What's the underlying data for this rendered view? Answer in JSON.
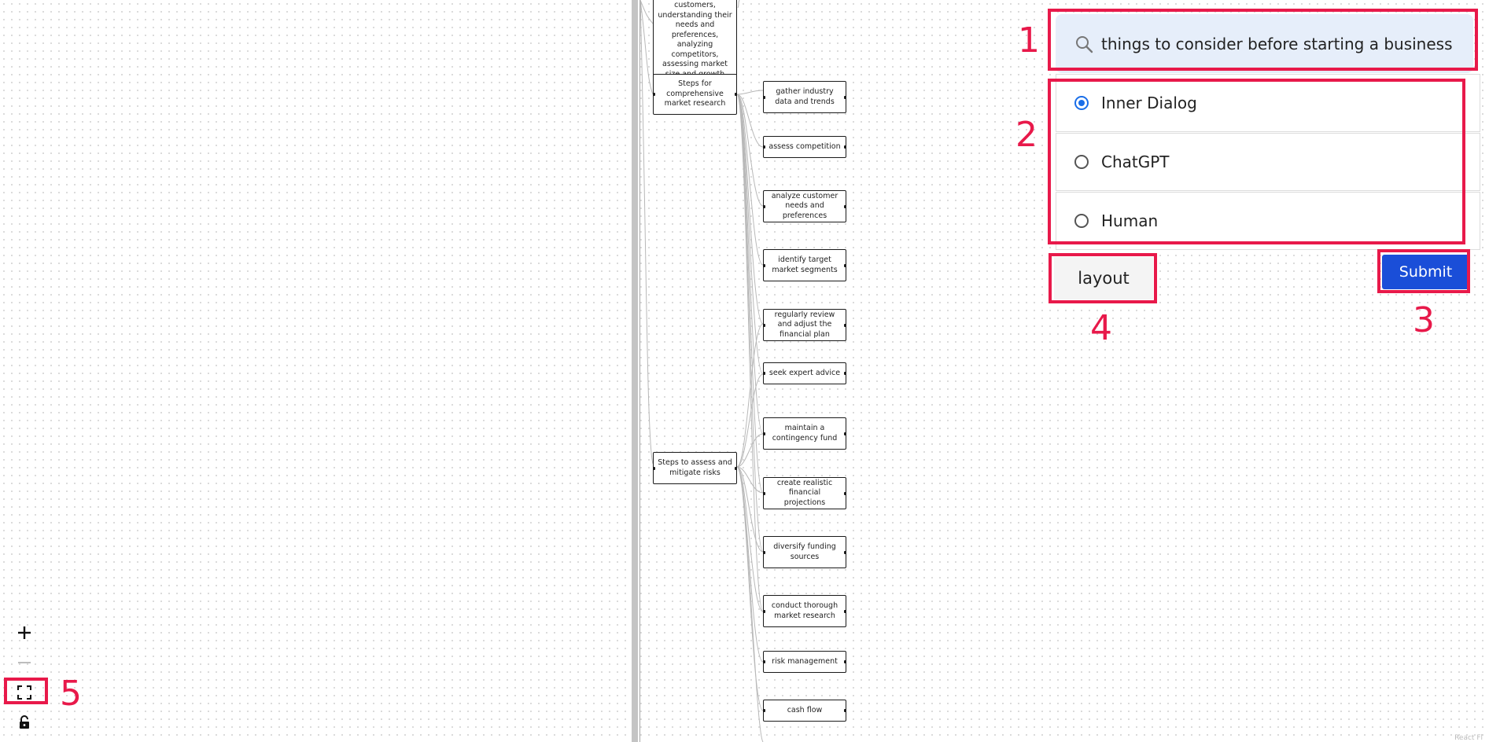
{
  "canvas": {
    "nodes": {
      "research_desc": "customers, understanding their needs and preferences, analyzing competitors, assessing market size and growth potential, and evaluating industry trends and regulations",
      "market_research": "Steps for comprehensive market research",
      "gather_data": "gather industry data and trends",
      "assess_competition": "assess competition",
      "analyze_needs": "analyze customer needs and preferences",
      "identify_segments": "identify target market segments",
      "review_plan": "regularly review and adjust the financial plan",
      "expert_advice": "seek expert advice",
      "contingency": "maintain a contingency fund",
      "projections": "create realistic financial projections",
      "diversify": "diversify funding sources",
      "conduct_research": "conduct thorough market research",
      "assess_risks": "Steps to assess and mitigate risks",
      "risk_management": "risk management",
      "cash_flow": "cash flow"
    },
    "watermark": "React Fl"
  },
  "search": {
    "value": "things to consider before starting a business",
    "icon": "search-icon"
  },
  "options": {
    "items": [
      {
        "label": "Inner Dialog",
        "selected": true
      },
      {
        "label": "ChatGPT",
        "selected": false
      },
      {
        "label": "Human",
        "selected": false
      }
    ]
  },
  "buttons": {
    "layout": "layout",
    "submit": "Submit"
  },
  "controls": {
    "zoom_in": "plus-icon",
    "zoom_out": "minus-icon",
    "fit_view": "fit-view-icon",
    "lock": "lock-icon"
  },
  "annotations": {
    "a1": "1",
    "a2": "2",
    "a3": "3",
    "a4": "4",
    "a5": "5"
  },
  "colors": {
    "annotation": "#e8194a",
    "submit": "#1a4ed8",
    "radio_selected": "#1a6ee8",
    "search_bg": "#e6eefa"
  }
}
